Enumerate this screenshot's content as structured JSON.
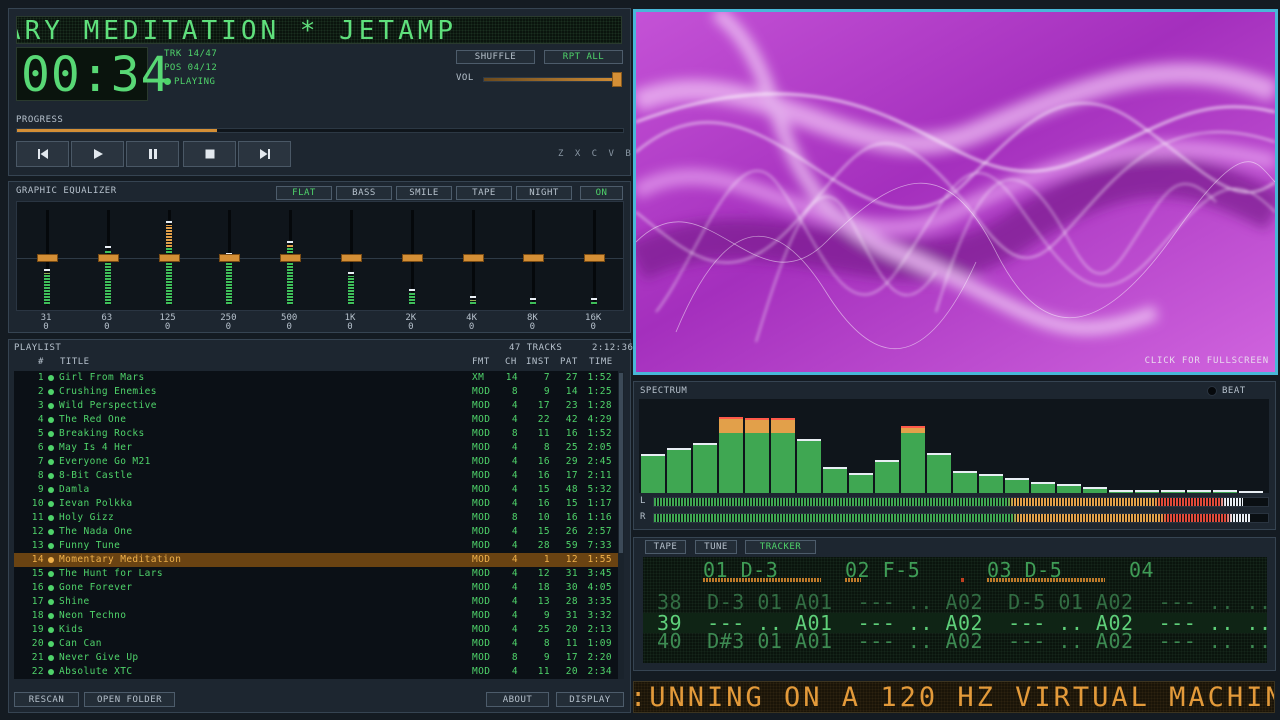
{
  "player": {
    "title_marquee": "ARY MEDITATION  *  JETAMP",
    "time": "00:34",
    "track": "TRK 14/47",
    "position": "POS 04/12",
    "state": "PLAYING",
    "shuffle_label": "SHUFFLE",
    "repeat_label": "RPT ALL",
    "vol_label": "VOL",
    "volume": 1.0,
    "progress_label": "PROGRESS",
    "progress": 0.33,
    "shortcuts": "Z X C V B",
    "transport": [
      "prev-icon",
      "play-icon",
      "pause-icon",
      "stop-icon",
      "next-icon"
    ]
  },
  "equalizer": {
    "title": "GRAPHIC EQUALIZER",
    "presets": [
      "FLAT",
      "BASS",
      "SMILE",
      "TAPE",
      "NIGHT"
    ],
    "active_preset": "FLAT",
    "toggle_label": "ON",
    "bands": [
      {
        "freq": "31",
        "gain": "0",
        "level": 0.34
      },
      {
        "freq": "63",
        "gain": "0",
        "level": 0.6
      },
      {
        "freq": "125",
        "gain": "0",
        "level": 0.88
      },
      {
        "freq": "250",
        "gain": "0",
        "level": 0.52
      },
      {
        "freq": "500",
        "gain": "0",
        "level": 0.66
      },
      {
        "freq": "1K",
        "gain": "0",
        "level": 0.31
      },
      {
        "freq": "2K",
        "gain": "0",
        "level": 0.12
      },
      {
        "freq": "4K",
        "gain": "0",
        "level": 0.04
      },
      {
        "freq": "8K",
        "gain": "0",
        "level": 0.01
      },
      {
        "freq": "16K",
        "gain": "0",
        "level": 0.01
      }
    ]
  },
  "playlist": {
    "title": "PLAYLIST",
    "count": "47 TRACKS",
    "total_time": "2:12:36",
    "headers": {
      "num": "#",
      "title": "TITLE",
      "fmt": "FMT",
      "ch": "CH",
      "inst": "INST",
      "pat": "PAT",
      "time": "TIME"
    },
    "active_index": 13,
    "tracks": [
      [
        "1",
        "Girl From Mars",
        "XM",
        "14",
        "7",
        "27",
        "1:52"
      ],
      [
        "2",
        "Crushing Enemies",
        "MOD",
        "8",
        "9",
        "14",
        "1:25"
      ],
      [
        "3",
        "Wild Perspective",
        "MOD",
        "4",
        "17",
        "23",
        "1:28"
      ],
      [
        "4",
        "The Red One",
        "MOD",
        "4",
        "22",
        "42",
        "4:29"
      ],
      [
        "5",
        "Breaking Rocks",
        "MOD",
        "8",
        "11",
        "16",
        "1:52"
      ],
      [
        "6",
        "May Is 4 Her",
        "MOD",
        "4",
        "8",
        "25",
        "2:05"
      ],
      [
        "7",
        "Everyone Go M21",
        "MOD",
        "4",
        "16",
        "29",
        "2:45"
      ],
      [
        "8",
        "8-Bit Castle",
        "MOD",
        "4",
        "16",
        "17",
        "2:11"
      ],
      [
        "9",
        "Damla",
        "MOD",
        "4",
        "15",
        "48",
        "5:32"
      ],
      [
        "10",
        "Ievan Polkka",
        "MOD",
        "4",
        "16",
        "15",
        "1:17"
      ],
      [
        "11",
        "Holy Gizz",
        "MOD",
        "8",
        "10",
        "16",
        "1:16"
      ],
      [
        "12",
        "The Nada One",
        "MOD",
        "4",
        "15",
        "26",
        "2:57"
      ],
      [
        "13",
        "Funny Tune",
        "MOD",
        "4",
        "28",
        "59",
        "7:33"
      ],
      [
        "14",
        "Momentary Meditation",
        "MOD",
        "4",
        "1",
        "12",
        "1:55"
      ],
      [
        "15",
        "The Hunt for Lars",
        "MOD",
        "4",
        "12",
        "31",
        "3:45"
      ],
      [
        "16",
        "Gone Forever",
        "MOD",
        "4",
        "18",
        "30",
        "4:05"
      ],
      [
        "17",
        "Shine",
        "MOD",
        "4",
        "13",
        "28",
        "3:35"
      ],
      [
        "18",
        "Neon Techno",
        "MOD",
        "4",
        "9",
        "31",
        "3:32"
      ],
      [
        "19",
        "Kids",
        "MOD",
        "4",
        "25",
        "20",
        "2:13"
      ],
      [
        "20",
        "Can Can",
        "MOD",
        "4",
        "8",
        "11",
        "1:09"
      ],
      [
        "21",
        "Never Give Up",
        "MOD",
        "8",
        "9",
        "17",
        "2:20"
      ],
      [
        "22",
        "Absolute XTC",
        "MOD",
        "4",
        "11",
        "20",
        "2:34"
      ]
    ],
    "buttons": {
      "rescan": "RESCAN",
      "open": "OPEN FOLDER",
      "about": "ABOUT",
      "display": "DISPLAY"
    }
  },
  "visualizer": {
    "hint": "CLICK FOR FULLSCREEN"
  },
  "spectrum": {
    "title": "SPECTRUM",
    "beat_label": "BEAT",
    "bars": [
      0.45,
      0.52,
      0.58,
      0.88,
      0.87,
      0.87,
      0.63,
      0.3,
      0.23,
      0.38,
      0.78,
      0.46,
      0.26,
      0.22,
      0.17,
      0.13,
      0.1,
      0.07,
      0.04,
      0.03,
      0.03,
      0.03,
      0.03,
      0.02
    ],
    "left_label": "L",
    "right_label": "R",
    "left_level": 0.96,
    "right_level": 0.97
  },
  "tracker": {
    "tabs": [
      "TAPE",
      "TUNE",
      "TRACKER"
    ],
    "active_tab": "TRACKER",
    "channels": [
      "01 D-3",
      "02 F-5",
      "03 D-5",
      "04"
    ],
    "rows": [
      "38  D-3 01 A01  --- .. A02  D-5 01 A02  --- .. ...",
      "39  --- .. A01  --- .. A02  --- .. A02  --- .. ...",
      "40  D#3 01 A01  --- .. A02  --- .. A02  --- .. ..."
    ],
    "current_row": "39"
  },
  "ticker": {
    "text": ":UNNING ON A 120 HZ VIRTUAL MACHINE"
  },
  "colors": {
    "lcd_green": "#5fe07c",
    "accent_orange": "#d48f36",
    "frame_blue": "#49b7d8",
    "viz_magenta": "#b040c8"
  }
}
